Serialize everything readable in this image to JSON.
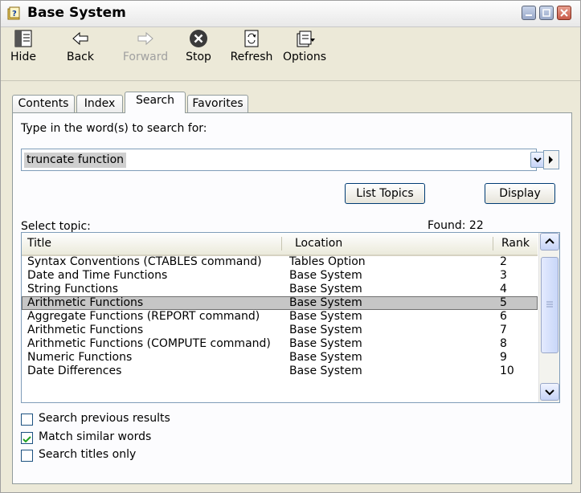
{
  "window": {
    "title": "Base System"
  },
  "toolbar": {
    "hide": "Hide",
    "back": "Back",
    "forward": "Forward",
    "stop": "Stop",
    "refresh": "Refresh",
    "options": "Options"
  },
  "tabs": [
    "Contents",
    "Index",
    "Search",
    "Favorites"
  ],
  "active_tab": "Search",
  "search": {
    "prompt": "Type in the word(s) to search for:",
    "value": "truncate function",
    "list_topics_button": "List Topics",
    "display_button": "Display"
  },
  "results": {
    "select_label": "Select topic:",
    "found_text": "Found: 22",
    "columns": [
      "Title",
      "Location",
      "Rank"
    ],
    "rows": [
      {
        "title": "Syntax Conventions (CTABLES command)",
        "location": "Tables Option",
        "rank": "2"
      },
      {
        "title": "Date and Time Functions",
        "location": "Base System",
        "rank": "3"
      },
      {
        "title": "String Functions",
        "location": "Base System",
        "rank": "4"
      },
      {
        "title": "Arithmetic Functions",
        "location": "Base System",
        "rank": "5",
        "selected": true
      },
      {
        "title": "Aggregate Functions (REPORT command)",
        "location": "Base System",
        "rank": "6"
      },
      {
        "title": "Arithmetic Functions",
        "location": "Base System",
        "rank": "7"
      },
      {
        "title": "Arithmetic Functions (COMPUTE command)",
        "location": "Base System",
        "rank": "8"
      },
      {
        "title": "Numeric Functions",
        "location": "Base System",
        "rank": "9"
      },
      {
        "title": "Date Differences",
        "location": "Base System",
        "rank": "10"
      }
    ]
  },
  "options": [
    {
      "label": "Search previous results",
      "checked": false
    },
    {
      "label": "Match similar words",
      "checked": true
    },
    {
      "label": "Search titles only",
      "checked": false
    }
  ],
  "colors": {
    "face": "#ece9d8",
    "panel": "#fcfcfe",
    "selected_row": "#c6c6c6",
    "border": "#7f9db9"
  }
}
